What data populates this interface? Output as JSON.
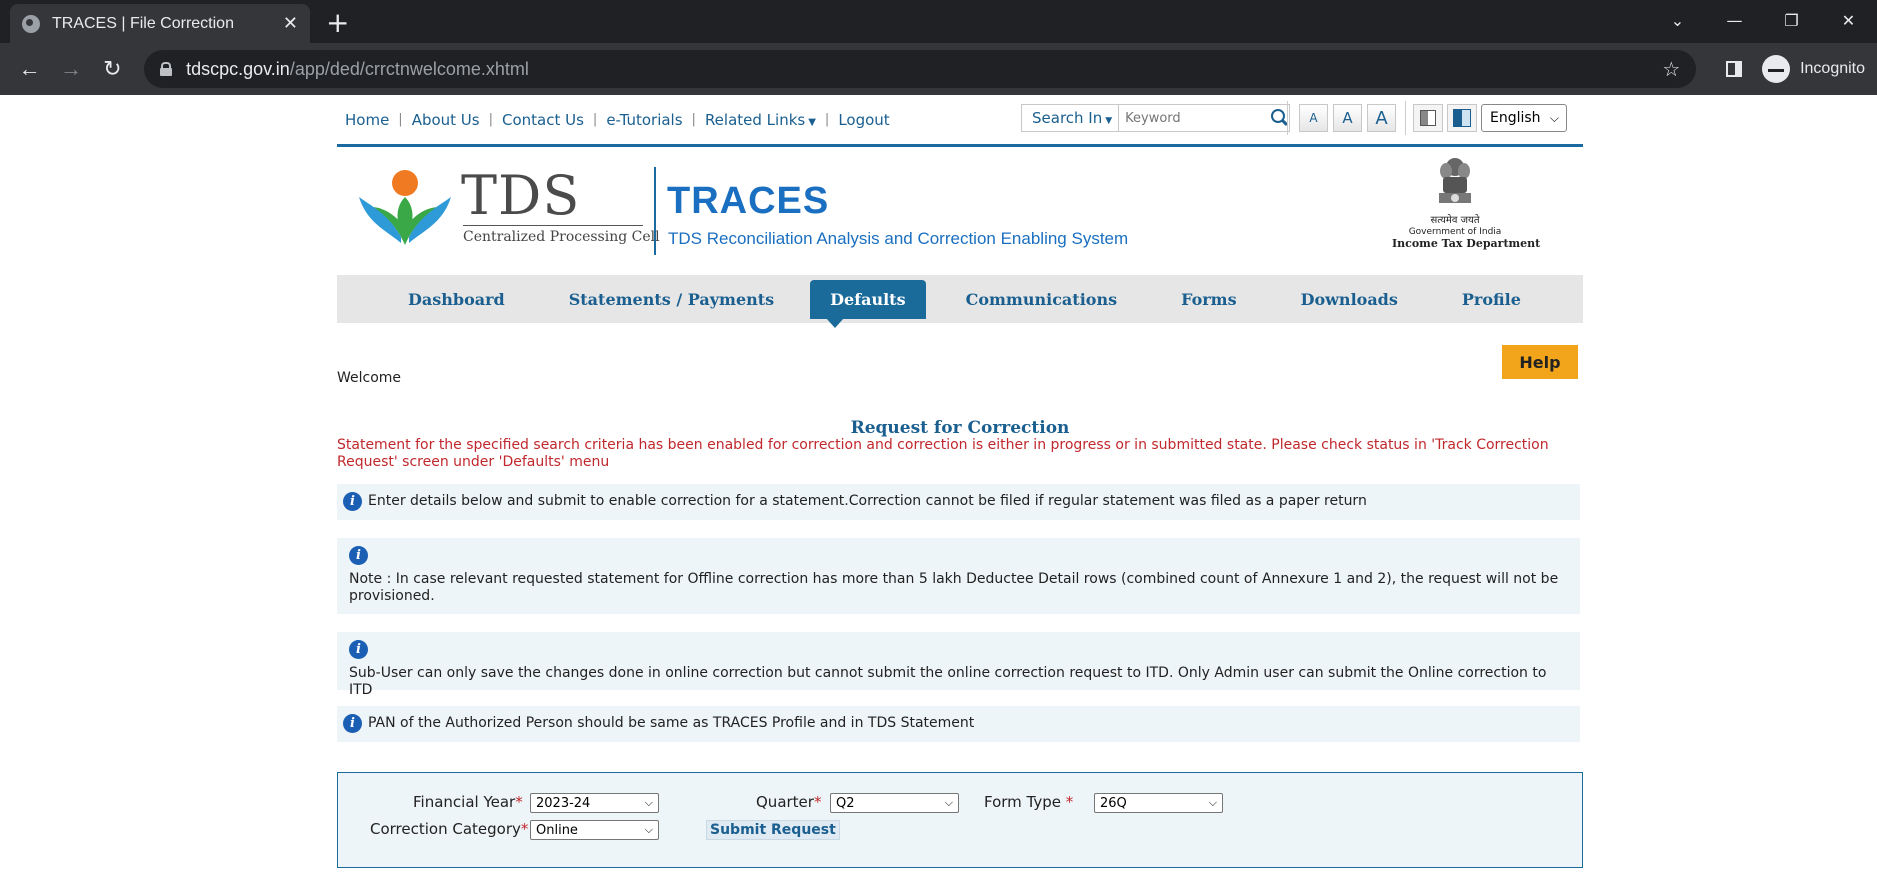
{
  "browser": {
    "tab_title": "TRACES | File Correction",
    "url_host": "tdscpc.gov.in",
    "url_path": "/app/ded/crrctnwelcome.xhtml",
    "profile_label": "Incognito"
  },
  "toplinks": [
    {
      "label": "Home"
    },
    {
      "label": "About Us"
    },
    {
      "label": "Contact Us"
    },
    {
      "label": "e-Tutorials"
    },
    {
      "label": "Related Links"
    },
    {
      "label": "Logout"
    }
  ],
  "search": {
    "scope_label": "Search In",
    "placeholder": "Keyword"
  },
  "font_size_buttons": [
    "A",
    "A",
    "A"
  ],
  "language": "English",
  "banner": {
    "tds_title": "TDS",
    "tds_subtitle": "Centralized Processing Cell",
    "traces_title": "TRACES",
    "traces_subtitle": "TDS Reconciliation Analysis and Correction Enabling System",
    "emblem_motto": "सत्यमेव जयते",
    "emblem_gov": "Government of India",
    "emblem_dept": "Income Tax Department"
  },
  "mainnav": [
    {
      "label": "Dashboard"
    },
    {
      "label": "Statements / Payments"
    },
    {
      "label": "Defaults",
      "active": true
    },
    {
      "label": "Communications"
    },
    {
      "label": "Forms"
    },
    {
      "label": "Downloads"
    },
    {
      "label": "Profile"
    }
  ],
  "help_label": "Help",
  "welcome": "Welcome",
  "heading": "Request for Correction",
  "error_message": "Statement for the specified search criteria has been enabled for correction and correction is either in progress or in submitted state. Please check status in 'Track Correction Request' screen under 'Defaults' menu",
  "info": {
    "msg1": "Enter details below and submit to enable correction for a statement.Correction cannot be filed if regular statement was filed as a paper return",
    "msg2": "Note : In case relevant requested statement for Offline correction has more than 5 lakh Deductee Detail rows (combined count of Annexure 1 and 2), the request will not be provisioned.",
    "msg3": "Sub-User can only save the changes done in online correction but cannot submit the online correction request to ITD. Only Admin user can submit the Online correction to ITD",
    "msg4": "PAN of the Authorized Person should be same as TRACES Profile and in TDS Statement"
  },
  "form": {
    "financial_year_label": "Financial Year",
    "financial_year_value": "2023-24",
    "quarter_label": "Quarter",
    "quarter_value": "Q2",
    "form_type_label": "Form Type",
    "form_type_value": "26Q",
    "correction_category_label": "Correction Category",
    "correction_category_value": "Online",
    "submit_label": "Submit Request",
    "required_mark": "*"
  },
  "colors": {
    "brand_blue": "#1a6a9a",
    "error_red": "#c0282d",
    "help_orange": "#f2a51a"
  }
}
